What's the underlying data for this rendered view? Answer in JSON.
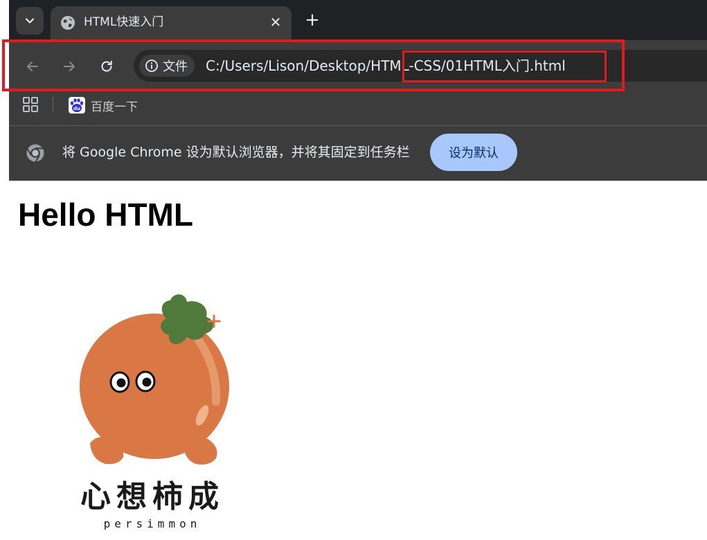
{
  "tab": {
    "title": "HTML快速入门",
    "close": "✕"
  },
  "new_tab": "+",
  "address": {
    "info_label": "文件",
    "url": "C:/Users/Lison/Desktop/HTML-CSS/01HTML入门.html"
  },
  "bookmarks": [
    {
      "label": "百度一下",
      "icon": "baidu-icon"
    }
  ],
  "infobar": {
    "message": "将 Google Chrome 设为默认浏览器，并将其固定到任务栏",
    "button": "设为默认"
  },
  "page": {
    "heading": "Hello HTML",
    "image": {
      "title": "心想柿成",
      "subtitle": "persimmon"
    }
  },
  "colors": {
    "annotation": "#e31a1c",
    "persimmon": "#d97844",
    "leaf": "#4f7a3c",
    "button": "#a8c7fa"
  }
}
